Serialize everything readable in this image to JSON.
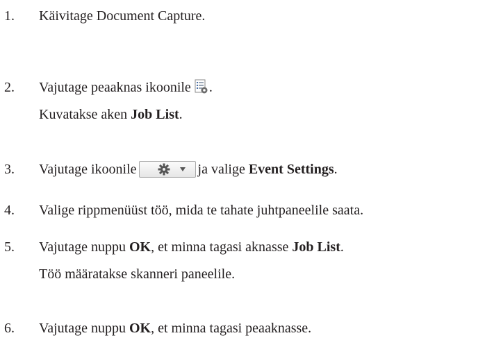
{
  "steps": [
    {
      "num": "1.",
      "text": "Käivitage Document Capture."
    },
    {
      "num": "2.",
      "text_before": "Vajutage peaaknas ikoonile",
      "text_after": ".",
      "note_prefix": "Kuvatakse aken ",
      "note_bold": "Job List",
      "note_suffix": ".",
      "icon": "job-settings-icon"
    },
    {
      "num": "3.",
      "text_before": "Vajutage ikoonile",
      "text_mid": "ja valige ",
      "bold": "Event Settings",
      "text_after": ".",
      "icon": "gear-dropdown-icon"
    },
    {
      "num": "4.",
      "text": "Valige rippmenüüst töö, mida te tahate juhtpaneelile saata."
    },
    {
      "num": "5.",
      "text_before": "Vajutage nuppu ",
      "bold1": "OK",
      "text_mid": ", et minna tagasi aknasse ",
      "bold2": "Job List",
      "text_after": ".",
      "note": "Töö määratakse skanneri paneelile."
    },
    {
      "num": "6.",
      "text_before": "Vajutage nuppu ",
      "bold1": "OK",
      "text_after": ", et minna tagasi peaaknasse."
    }
  ]
}
